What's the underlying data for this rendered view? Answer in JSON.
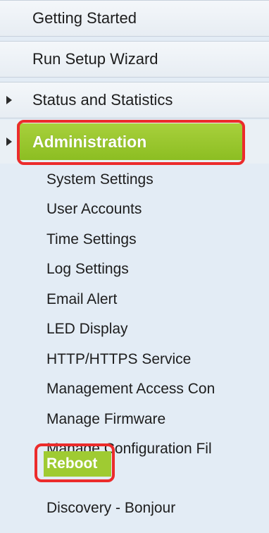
{
  "nav": {
    "top_items": [
      {
        "label": "Getting Started"
      },
      {
        "label": "Run Setup Wizard"
      },
      {
        "label": "Status and Statistics"
      }
    ],
    "active_section": {
      "label": "Administration"
    },
    "sub_items": [
      {
        "label": "System Settings"
      },
      {
        "label": "User Accounts"
      },
      {
        "label": "Time Settings"
      },
      {
        "label": "Log Settings"
      },
      {
        "label": "Email Alert"
      },
      {
        "label": "LED Display"
      },
      {
        "label": "HTTP/HTTPS Service"
      },
      {
        "label": "Management Access Con"
      },
      {
        "label": "Manage Firmware"
      },
      {
        "label": "Manage Configuration Fil"
      },
      {
        "label": "Reboot"
      },
      {
        "label": "Discovery - Bonjour"
      }
    ]
  },
  "colors": {
    "accent_green": "#8cbe22",
    "callout_red": "#ec2b2b",
    "panel_bg": "#e3ecf5"
  },
  "icons": {
    "collapse_arrow": "triangle-right-icon"
  }
}
